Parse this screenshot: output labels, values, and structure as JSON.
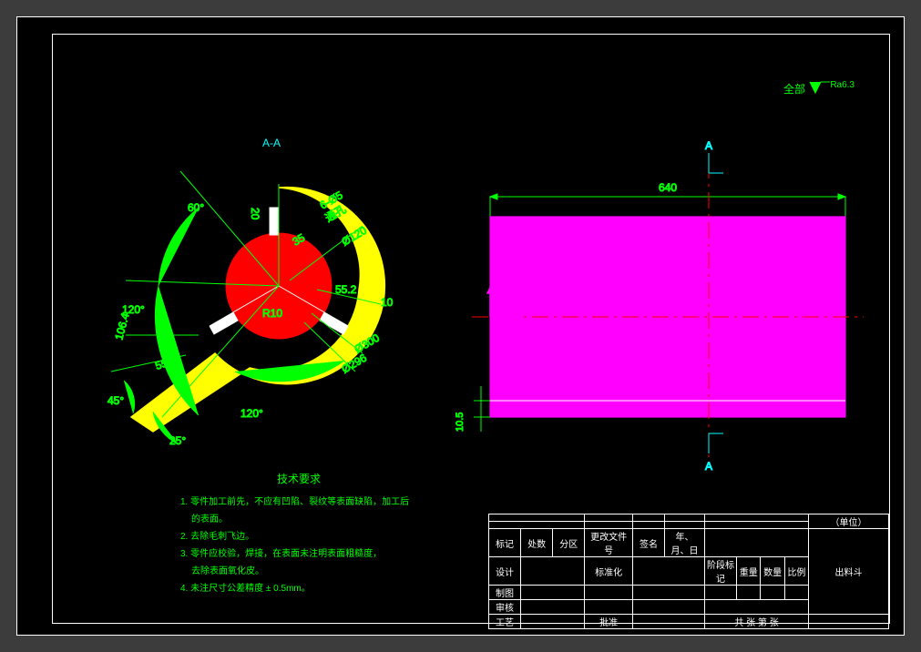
{
  "meta": {
    "section_label": "A-A",
    "roughness_prefix": "全部",
    "roughness_value": "Ra6.3"
  },
  "dims_left": {
    "ang60": "60°",
    "ang120a": "120°",
    "ang120b": "120°",
    "ang25": "25°",
    "ang45": "45°",
    "r10": "R10",
    "d120": "Ø120",
    "d300": "Ø300",
    "d296": "Ø296",
    "d55_2a": "55.2",
    "d55_2b": "55.2",
    "d10": "10",
    "d106_4": "106.4",
    "d35": "35",
    "holes": "6-Ø5\n通孔",
    "d20": "20"
  },
  "dims_right": {
    "len640": "640",
    "h10_5": "10.5",
    "mark_top": "A",
    "mark_bot": "A"
  },
  "notes": {
    "header": "技术要求",
    "l1": "1. 零件加工前先，不应有凹陷、裂纹等表面缺陷，加工后",
    "l1b": "的表面。",
    "l2": "2. 去除毛刺飞边。",
    "l3": "3. 零件应校验，焊接，在表面未注明表面粗糙度，",
    "l3b": "去除表面氧化皮。",
    "l4": "4. 未注尺寸公差精度 ± 0.5mm。"
  },
  "titleblock": {
    "unit": "（单位）",
    "part_name": "出料斗",
    "row_mark": "标记",
    "row_count": "处数",
    "row_zone": "分区",
    "row_change_doc": "更改文件号",
    "row_sign": "签名",
    "row_date": "年、月、日",
    "r_design": "设计",
    "r_std": "标准化",
    "r_stage": "阶段标记",
    "r_weight": "重量",
    "r_qty": "数量",
    "r_scale": "比例",
    "r_draw": "制图",
    "r_check": "审核",
    "r_proc": "工艺",
    "r_approve": "批准",
    "r_sheet": "共  张   第  张"
  }
}
